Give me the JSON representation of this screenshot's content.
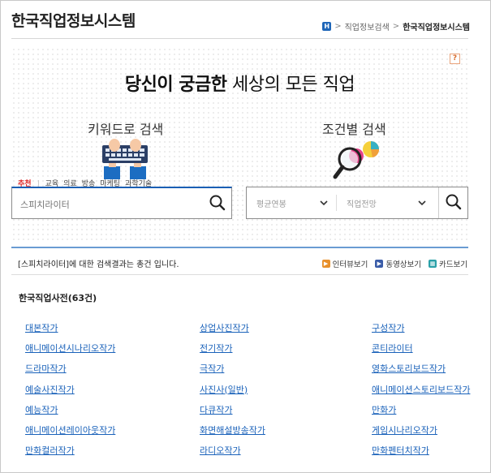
{
  "header": {
    "title": "한국직업정보시스템",
    "breadcrumb": {
      "home_icon": "home-icon",
      "level1": "직업정보검색",
      "separator": ">",
      "current": "한국직업정보시스템"
    }
  },
  "hero": {
    "help_label": "?",
    "headline_strong": "당신이 궁금한",
    "headline_normal": "세상의 모든 직업",
    "keyword_panel": {
      "title": "키워드로 검색",
      "illustration": "keyboard-typing-illustration"
    },
    "condition_panel": {
      "title": "조건별 검색",
      "illustration": "magnifier-pie-chart-illustration"
    },
    "search": {
      "value": "",
      "placeholder": "스피치라이터"
    },
    "condition": {
      "salary_select": "평균연봉",
      "outlook_select": "직업전망"
    },
    "tags": {
      "label": "추천",
      "items": [
        "교육",
        "의료",
        "방송",
        "마케팅",
        "과학기술"
      ]
    }
  },
  "results": {
    "summary": "[스피치라이터]에 대한 검색결과는 총건 입니다.",
    "views": [
      {
        "label": "인터뷰보기",
        "icon": "interview-icon",
        "color": "#e8902b"
      },
      {
        "label": "동영상보기",
        "icon": "video-icon",
        "color": "#3a5ca8"
      },
      {
        "label": "카드보기",
        "icon": "card-icon",
        "color": "#2aa0a8"
      }
    ],
    "dictionary_title": "한국직업사전(63건)",
    "jobs": [
      [
        "대본작가",
        "상업사진작가",
        "구성작가"
      ],
      [
        "애니메이션시나리오작가",
        "전기작가",
        "콘티라이터"
      ],
      [
        "드라마작가",
        "극작가",
        "영화스토리보드작가"
      ],
      [
        "예술사진작가",
        "사진사(일반)",
        "애니메이션스토리보드작가"
      ],
      [
        "예능작가",
        "다큐작가",
        "만화가"
      ],
      [
        "애니메이션레이아웃작가",
        "화면해설방송작가",
        "게임시나리오작가"
      ],
      [
        "만화컬러작가",
        "라디오작가",
        "만화펜터치작가"
      ]
    ]
  },
  "colors": {
    "accent_blue": "#1a5fb4",
    "link": "#1a62ba",
    "tag_label": "#dd2222",
    "rule": "#6a9bd3"
  }
}
